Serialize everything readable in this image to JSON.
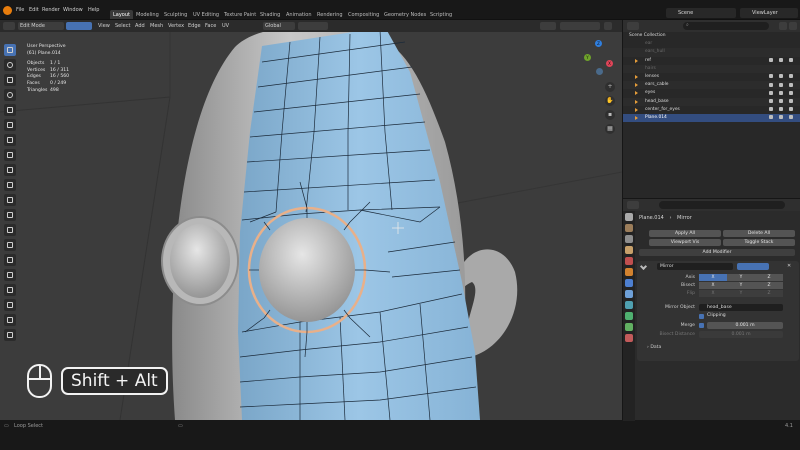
{
  "menubar": {
    "menus": [
      "File",
      "Edit",
      "Render",
      "Window",
      "Help"
    ],
    "workspaces": [
      "Layout",
      "Modeling",
      "Sculpting",
      "UV Editing",
      "Texture Paint",
      "Shading",
      "Animation",
      "Rendering",
      "Compositing",
      "Geometry Nodes",
      "Scripting"
    ],
    "active_workspace": "Layout",
    "scene": "Scene",
    "view_layer": "ViewLayer"
  },
  "viewport_header": {
    "mode": "Edit Mode",
    "menus": [
      "View",
      "Select",
      "Add",
      "Mesh",
      "Vertex",
      "Edge",
      "Face",
      "UV"
    ],
    "orientation": "Global",
    "options": "Options"
  },
  "stats": {
    "view": "User Perspective",
    "object": "(61) Plane.014",
    "rows": [
      {
        "k": "Objects",
        "v": "1 / 1"
      },
      {
        "k": "Vertices",
        "v": "16 / 311"
      },
      {
        "k": "Edges",
        "v": "16 / 560"
      },
      {
        "k": "Faces",
        "v": "0 / 249"
      },
      {
        "k": "Triangles",
        "v": "498"
      }
    ]
  },
  "gizmo": {
    "x": "X",
    "y": "Y",
    "z": "Z"
  },
  "shortcut": {
    "key": "Shift + Alt"
  },
  "statusbar": {
    "left": "Loop Select",
    "right": "4.1"
  },
  "outliner": {
    "search_placeholder": "",
    "root": "Scene Collection",
    "rows": [
      {
        "name": "ear",
        "visible": false
      },
      {
        "name": "ears_hull",
        "visible": false
      },
      {
        "name": "ref",
        "visible": true
      },
      {
        "name": "hairs",
        "visible": false
      },
      {
        "name": "lenses",
        "visible": true
      },
      {
        "name": "ears_cable",
        "visible": true
      },
      {
        "name": "eyes",
        "visible": true
      },
      {
        "name": "head_base",
        "visible": true
      },
      {
        "name": "center_for_eyes",
        "visible": true
      },
      {
        "name": "Plane.014",
        "visible": true,
        "selected": true
      }
    ]
  },
  "properties": {
    "object": "Plane.014",
    "modifier": "Mirror",
    "apply_all": "Apply All",
    "delete_all": "Delete All",
    "viewport_vis": "Viewport Vis",
    "toggle_stack": "Toggle Stack",
    "add_modifier": "Add Modifier",
    "mod_name": "Mirror",
    "axis_label": "Axis",
    "bisect_label": "Bisect",
    "flip_label": "Flip",
    "axes": [
      "X",
      "Y",
      "Z"
    ],
    "mirror_object_label": "Mirror Object",
    "mirror_object": "head_base",
    "clipping": "Clipping",
    "merge_label": "Merge",
    "merge_value": "0.001 m",
    "bisect_distance_label": "Bisect Distance",
    "bisect_distance_value": "0.001 m",
    "data": "Data"
  }
}
